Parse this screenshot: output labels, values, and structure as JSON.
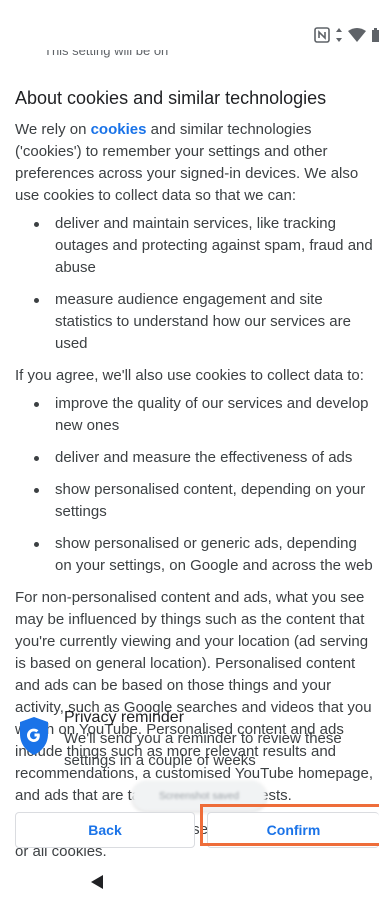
{
  "status_bar": {
    "icons": [
      "nfc-icon",
      "data-arrows-icon",
      "wifi-icon",
      "battery-icon"
    ]
  },
  "cut_off_text": "This setting will be on",
  "section": {
    "heading": "About cookies and similar technologies",
    "intro_before_link": "We rely on ",
    "intro_link": "cookies",
    "intro_after_link": " and similar technologies ('cookies') to remember your settings and other preferences across your signed-in devices. We also use cookies to collect data so that we can:",
    "bullets_1": [
      "deliver and maintain services, like tracking outages and protecting against spam, fraud and abuse",
      "measure audience engagement and site statistics to understand how our services are used"
    ],
    "agree_text": "If you agree, we'll also use cookies to collect data to:",
    "bullets_2": [
      "improve the quality of our services and develop new ones",
      "deliver and measure the effectiveness of ads",
      "show personalised content, depending on your settings",
      "show personalised or generic ads, depending on your settings, on Google and across the web"
    ],
    "nonpersonalised_para": "For non-personalised content and ads, what you see may be influenced by things such as the content that you're currently viewing and your location (ad serving is based on general location). Personalised content and ads can be based on those things and your activity, such as Google searches and videos that you watch on YouTube. Personalised content and ads include things such as more relevant results and recommendations, a customised YouTube homepage, and ads that are tailored to your interests.",
    "browser_para": "You can change your browser settings to reject some or all cookies."
  },
  "reminder": {
    "title": "Privacy reminder",
    "body": "We'll send you a reminder to review these settings in a couple of weeks"
  },
  "toast": {
    "text": "Screenshot saved"
  },
  "buttons": {
    "back_label": "Back",
    "confirm_label": "Confirm"
  },
  "colors": {
    "link": "#1a73e8",
    "shield": "#1a73e8",
    "highlight": "#ee6d3a"
  }
}
